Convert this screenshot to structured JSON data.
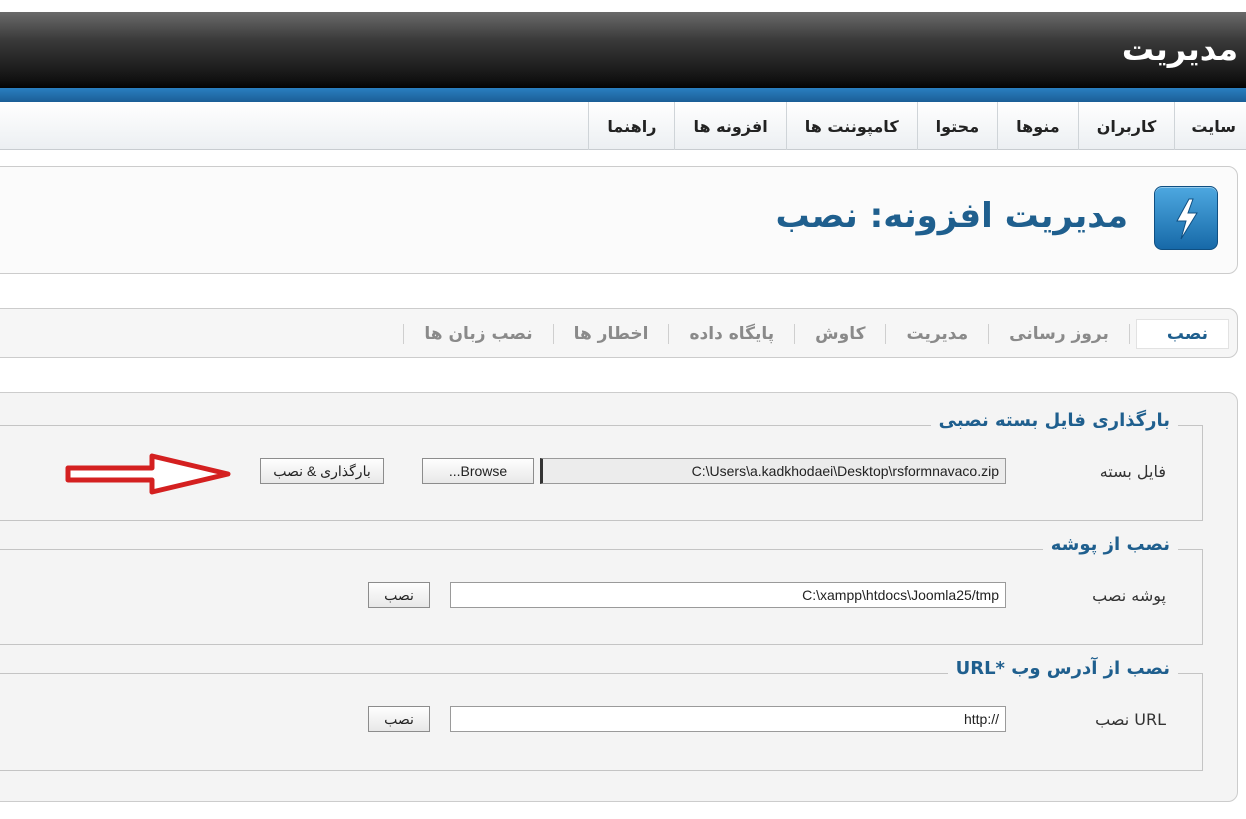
{
  "header": {
    "title": "مدیریت"
  },
  "menu": {
    "items": [
      {
        "label": "سایت"
      },
      {
        "label": "کاربران"
      },
      {
        "label": "منوها"
      },
      {
        "label": "محتوا"
      },
      {
        "label": "کامپوننت ها"
      },
      {
        "label": "افزونه ها"
      },
      {
        "label": "راهنما"
      }
    ]
  },
  "toolbar": {
    "title": "مدیریت افزونه: نصب",
    "icon": "extension-lightning-icon"
  },
  "submenu": {
    "items": [
      {
        "label": "نصب",
        "active": true
      },
      {
        "label": "بروز رسانی"
      },
      {
        "label": "مدیریت"
      },
      {
        "label": "کاوش"
      },
      {
        "label": "پایگاه داده"
      },
      {
        "label": "اخطار ها"
      },
      {
        "label": "نصب زبان ها"
      }
    ]
  },
  "upload": {
    "legend": "بارگذاری فایل بسته نصبی",
    "label": "فایل بسته",
    "value": "C:\\Users\\a.kadkhodaei\\Desktop\\rsformnavaco.zip",
    "browse_label": "Browse...",
    "submit_label": "بارگذاری & نصب"
  },
  "folder": {
    "legend": "نصب از پوشه",
    "label": "پوشه نصب",
    "value": "C:\\xampp\\htdocs\\Joomla25/tmp",
    "submit_label": "نصب"
  },
  "url": {
    "legend": "نصب از آدرس وب *URL",
    "label": "URL نصب",
    "value": "http://",
    "submit_label": "نصب"
  },
  "colors": {
    "accent": "#1f5f8e",
    "bluebar": "#2a7fc0",
    "arrow": "#d42020"
  }
}
